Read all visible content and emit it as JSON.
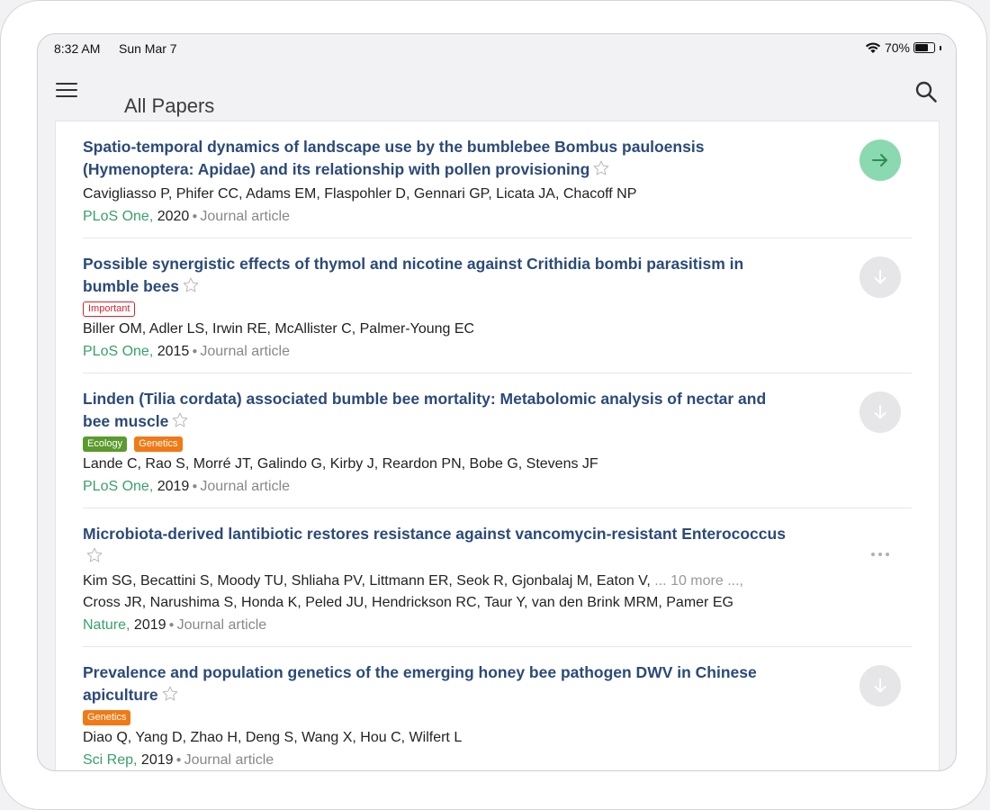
{
  "status_bar": {
    "time": "8:32 AM",
    "date": "Sun Mar 7",
    "battery": "70%",
    "battery_level": 0.7
  },
  "header": {
    "title": "All Papers",
    "menu_icon": "hamburger-menu-icon",
    "search_icon": "search-icon"
  },
  "colors": {
    "title": "#2b4a78",
    "journal": "#38a169",
    "open_button": "#8bd9b0",
    "download_button": "#e6e6e8",
    "tag_important": "#d9242b",
    "tag_ecology": "#5b9a2d",
    "tag_genetics": "#ef7a16"
  },
  "papers": [
    {
      "title": "Spatio-temporal dynamics of landscape use by the bumblebee Bombus pauloensis (Hymenoptera: Apidae) and its relationship with pollen provisioning",
      "tags": [],
      "authors": "Cavigliasso P, Phifer CC, Adams EM, Flaspohler D, Gennari GP, Licata JA, Chacoff NP",
      "journal": "PLoS One,",
      "year": "2020",
      "type": "Journal article",
      "action": "open"
    },
    {
      "title": "Possible synergistic effects of thymol and nicotine against Crithidia bombi parasitism in bumble bees",
      "tags": [
        "Important"
      ],
      "authors": "Biller OM, Adler LS, Irwin RE, McAllister C, Palmer-Young EC",
      "journal": "PLoS One,",
      "year": "2015",
      "type": "Journal article",
      "action": "download"
    },
    {
      "title": "Linden (Tilia cordata) associated bumble bee mortality: Metabolomic analysis of nectar and bee muscle",
      "tags": [
        "Ecology",
        "Genetics"
      ],
      "authors": "Lande C, Rao S, Morré JT, Galindo G, Kirby J, Reardon PN, Bobe G, Stevens JF",
      "journal": "PLoS One,",
      "year": "2019",
      "type": "Journal article",
      "action": "download"
    },
    {
      "title": "Microbiota-derived lantibiotic restores resistance against vancomycin-resistant Enterococcus",
      "tags": [],
      "authors": "Kim SG, Becattini S, Moody TU, Shliaha PV, Littmann ER, Seok R, Gjonbalaj M, Eaton V,",
      "authors_more": "... 10 more ...,",
      "authors_cont": "Cross JR, Narushima S, Honda K, Peled JU, Hendrickson RC, Taur Y, van den Brink MRM, Pamer EG",
      "journal": "Nature,",
      "year": "2019",
      "type": "Journal article",
      "action": "more"
    },
    {
      "title": "Prevalence and population genetics of the emerging honey bee pathogen DWV in Chinese apiculture",
      "tags": [
        "Genetics"
      ],
      "authors": "Diao Q, Yang D, Zhao H, Deng S, Wang X, Hou C, Wilfert L",
      "journal": "Sci Rep,",
      "year": "2019",
      "type": "Journal article",
      "action": "download"
    }
  ]
}
